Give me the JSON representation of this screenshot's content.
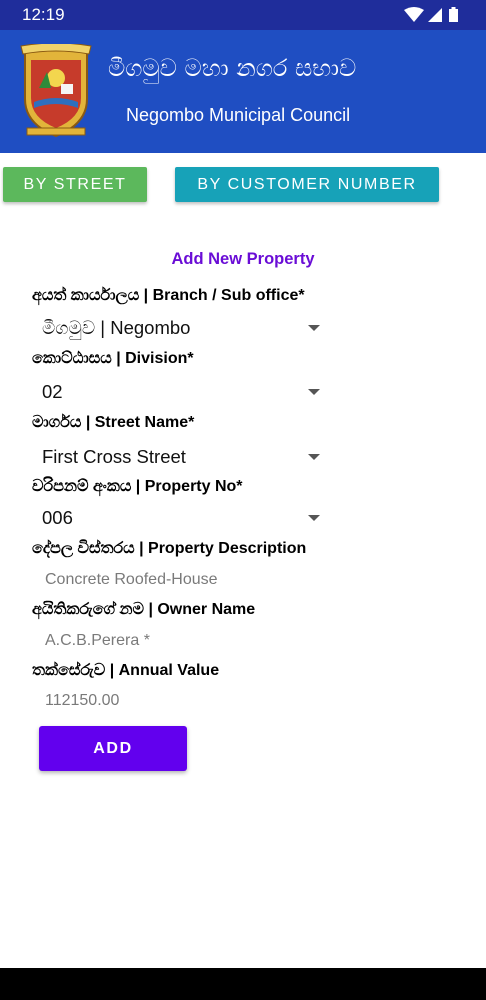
{
  "status": {
    "time": "12:19",
    "icons": [
      "wifi-icon",
      "signal-icon",
      "battery-icon"
    ]
  },
  "header": {
    "logo": "council-logo",
    "title_si": "මීගමුව මහා නගර සභාව",
    "title_en": "Negombo Municipal Council"
  },
  "tabs": {
    "by_street": "BY STREET",
    "by_customer": "BY CUSTOMER NUMBER"
  },
  "form": {
    "title": "Add New Property",
    "branch": {
      "label": "අයත් කාර්යාලය | Branch / Sub office*",
      "value": "මීගමුව | Negombo"
    },
    "division": {
      "label": "කොට්ඨාසය | Division*",
      "value": "02"
    },
    "street": {
      "label": "මාර්ගය | Street Name*",
      "value": "First Cross Street"
    },
    "property_no": {
      "label": "වරිපනම් අංකය | Property No*",
      "value": "006"
    },
    "description": {
      "label": "දේපල විස්තරය | Property Description",
      "value": "Concrete Roofed-House"
    },
    "owner": {
      "label": "අයිතිකරුගේ නම | Owner Name",
      "value": "A.C.B.Perera *"
    },
    "annual_value": {
      "label": "තක්සේරුව | Annual Value",
      "value": "112150.00"
    },
    "add_button": "ADD"
  },
  "colors": {
    "status_bar": "#1f2d9b",
    "header": "#1f4ec2",
    "by_street": "#5cb85c",
    "by_customer": "#17a2b8",
    "title": "#6a0dd6",
    "add_button": "#6200ee"
  }
}
